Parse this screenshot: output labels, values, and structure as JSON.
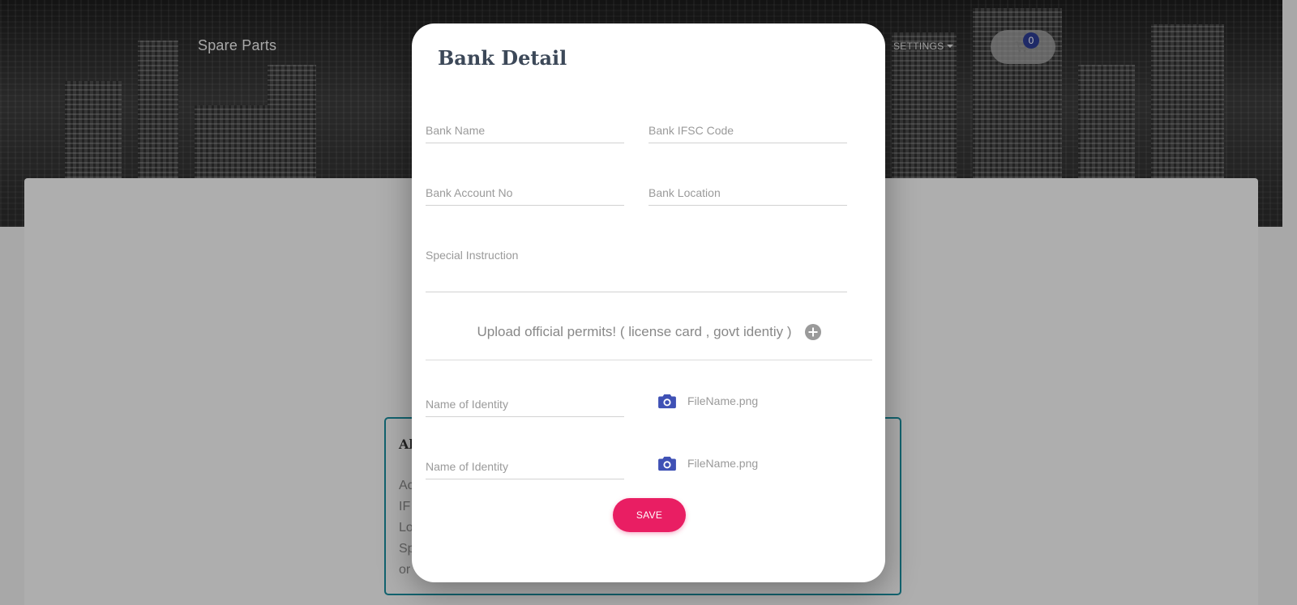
{
  "header": {
    "brand": "Spare Parts",
    "settings_label": "SETTINGS",
    "cart_count": "0"
  },
  "about_card": {
    "title": "Al",
    "lines": [
      "Ac",
      "IF",
      "Lo",
      "Sp",
      "or"
    ]
  },
  "modal": {
    "title": "Bank Detail",
    "fields": {
      "bank_name": {
        "placeholder": "Bank Name",
        "value": ""
      },
      "bank_ifsc": {
        "placeholder": "Bank IFSC Code",
        "value": ""
      },
      "bank_account": {
        "placeholder": "Bank Account No",
        "value": ""
      },
      "bank_location": {
        "placeholder": "Bank Location",
        "value": ""
      },
      "special_instruction": {
        "placeholder": "Special Instruction",
        "value": ""
      }
    },
    "upload_label": "Upload official permits! ( license card , govt identiy )",
    "identities": [
      {
        "placeholder": "Name of Identity",
        "file_name": "FileName.png"
      },
      {
        "placeholder": "Name of Identity",
        "file_name": "FileName.png"
      }
    ],
    "save_label": "SAVE"
  },
  "icons": {
    "cart": "shopping-cart-icon",
    "camera": "camera-icon",
    "add": "plus-circle-icon"
  },
  "colors": {
    "accent_button": "#e91e63",
    "camera_icon": "#3f51b5",
    "cart_badge": "#2c3b8f",
    "about_border": "#1a8a9a"
  }
}
